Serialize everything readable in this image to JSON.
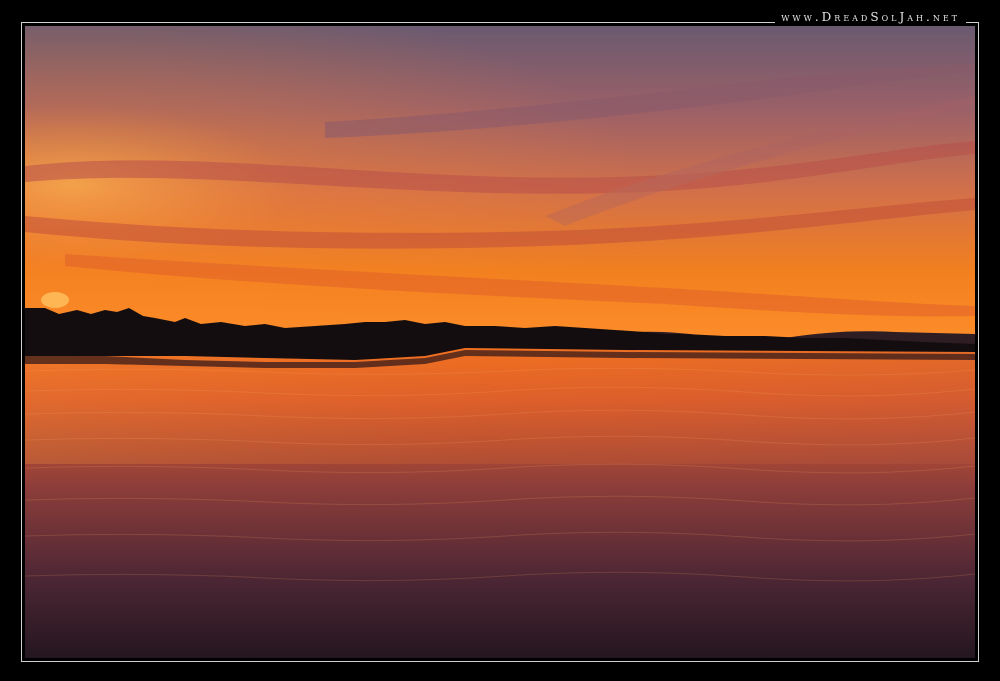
{
  "watermark": {
    "text": "www.DreadSolJah.net"
  },
  "photo": {
    "scene": "sunset-over-lake",
    "colors": {
      "sky_top": "#6d5a6e",
      "sky_mid": "#c86e4e",
      "sky_glow": "#f07a1c",
      "horizon": "#ff8a2a",
      "water_top": "#e8671e",
      "water_mid": "#7a3a38",
      "water_bottom": "#2a1a2a",
      "treeline": "#140d10",
      "frame_border": "#cfcfcf"
    }
  }
}
